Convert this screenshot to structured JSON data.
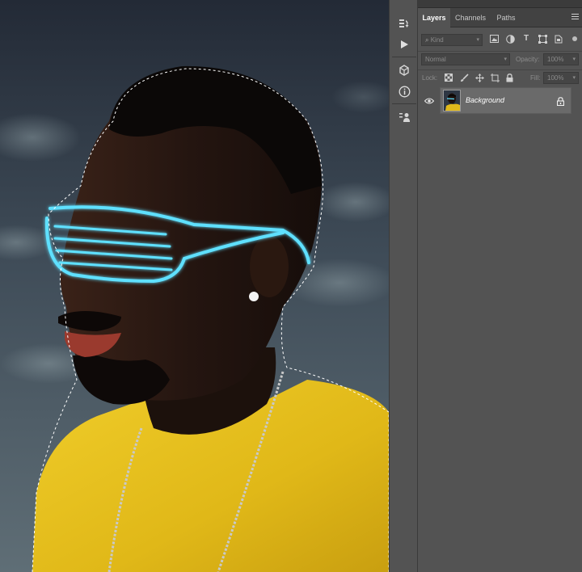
{
  "panel": {
    "tabs": [
      {
        "label": "Layers",
        "active": true
      },
      {
        "label": "Channels",
        "active": false
      },
      {
        "label": "Paths",
        "active": false
      }
    ],
    "collapse_glyph": "◂◂",
    "filter": {
      "kind_label": "Kind",
      "icons": [
        "image-filter-icon",
        "adjustment-filter-icon",
        "type-filter-icon",
        "shape-filter-icon",
        "smart-object-filter-icon"
      ]
    },
    "blend_mode": "Normal",
    "opacity_label": "Opacity:",
    "opacity_value": "100%",
    "lock_label": "Lock:",
    "fill_label": "Fill:",
    "fill_value": "100%",
    "layers": [
      {
        "name": "Background",
        "visible": true,
        "locked": true
      }
    ]
  },
  "tools": [
    "history-icon",
    "play-action-icon",
    "3d-cube-icon",
    "info-icon",
    "properties-icon"
  ],
  "colors": {
    "panel_bg": "#535353",
    "tab_bar_bg": "#424242",
    "selected_layer_bg": "#6a6a6a",
    "shirt_yellow": "#e8c21e",
    "glasses_glow": "#4fd8ff"
  }
}
